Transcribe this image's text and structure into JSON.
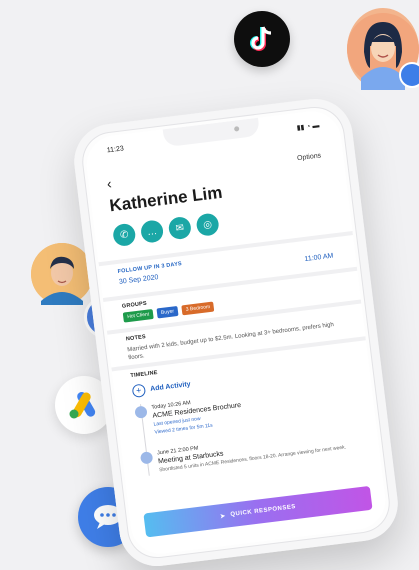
{
  "status": {
    "time": "11:23"
  },
  "header": {
    "back": "‹",
    "options": "Options"
  },
  "contact": {
    "name": "Katherine Lim"
  },
  "actions": [
    {
      "icon": "phone-icon",
      "glyph": "✆"
    },
    {
      "icon": "chat-bubble-icon",
      "glyph": "…"
    },
    {
      "icon": "mail-icon",
      "glyph": "✉"
    },
    {
      "icon": "whatsapp-icon",
      "glyph": "◎"
    }
  ],
  "follow_up": {
    "label": "FOLLOW UP IN 3 DAYS",
    "date": "30 Sep 2020",
    "time": "11:00 AM"
  },
  "groups": {
    "label": "GROUPS",
    "tags": [
      {
        "text": "Hot Client",
        "color": "#1e9b4b"
      },
      {
        "text": "Buyer",
        "color": "#2a68c9"
      },
      {
        "text": "3 Bedroom",
        "color": "#d86b2a"
      }
    ]
  },
  "notes": {
    "label": "NOTES",
    "text": "Married with 2 kids, budget up to $2.5m. Looking at 3+ bedrooms, prefers high floors."
  },
  "timeline": {
    "label": "TIMELINE",
    "add": "Add Activity",
    "events": [
      {
        "when": "Today  10:26 AM",
        "title": "ACME Residences Brochure",
        "sub1": "Last opened just now",
        "sub2": "Viewed 2 times for 5m 11s"
      },
      {
        "when": "June 21  2:00 PM",
        "title": "Meeting at Starbucks",
        "desc": "Shortlisted 5 units in ACME Residences. floors 18-20. Arrange viewing for next week."
      }
    ]
  },
  "quick_responses": "QUICK RESPONSES"
}
